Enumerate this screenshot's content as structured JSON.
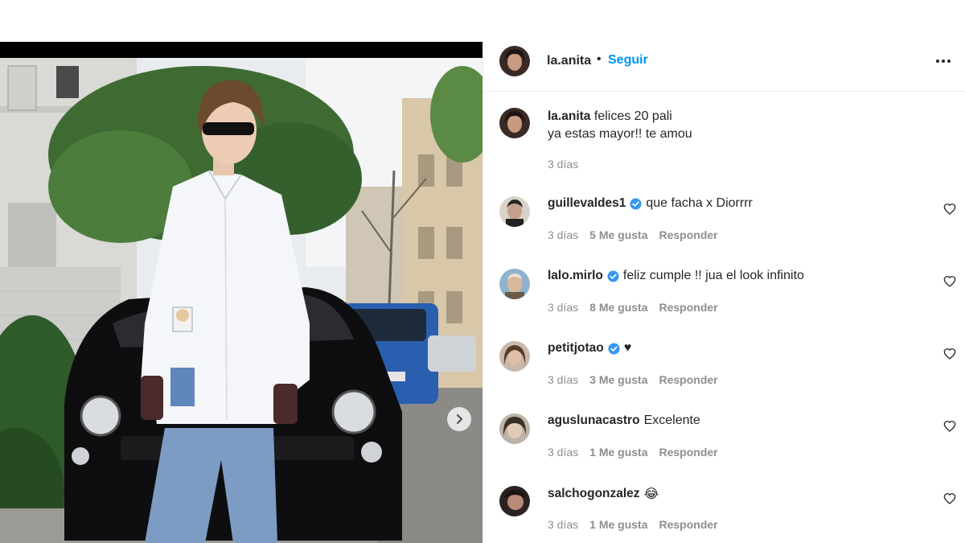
{
  "post": {
    "author": "la.anita",
    "separator": "•",
    "follow_label": "Seguir",
    "more_icon": "more-horizontal-icon"
  },
  "caption": {
    "user": "la.anita",
    "text_line1": "felices 20 pali",
    "text_line2": "ya estas mayor!! te amou",
    "time": "3 días"
  },
  "comments": [
    {
      "user": "guillevaldes1",
      "verified": true,
      "text": "que facha x Diorrrr",
      "time": "3 días",
      "likes": "5 Me gusta",
      "reply": "Responder"
    },
    {
      "user": "lalo.mirlo",
      "verified": true,
      "text": "feliz cumple !! jua el look infinito",
      "time": "3 días",
      "likes": "8 Me gusta",
      "reply": "Responder"
    },
    {
      "user": "petitjotao",
      "verified": true,
      "text": "♥",
      "time": "3 días",
      "likes": "3 Me gusta",
      "reply": "Responder"
    },
    {
      "user": "aguslunacastro",
      "verified": false,
      "text": "Excelente",
      "time": "3 días",
      "likes": "1 Me gusta",
      "reply": "Responder"
    },
    {
      "user": "salchogonzalez",
      "verified": false,
      "text": "😂",
      "time": "3 días",
      "likes": "1 Me gusta",
      "reply": "Responder"
    }
  ],
  "colors": {
    "follow_blue": "#0095f6",
    "verified_blue": "#3897f0",
    "meta_gray": "#8e8e8e",
    "text": "#262626"
  }
}
